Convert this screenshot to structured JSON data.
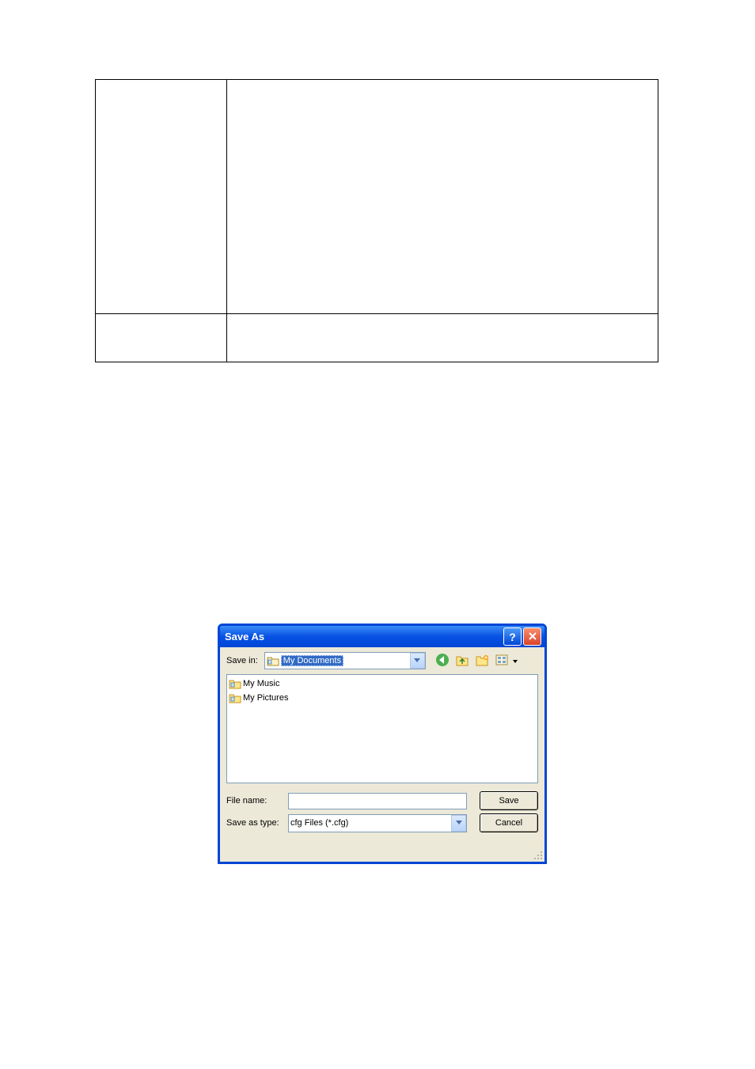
{
  "dialog": {
    "title": "Save As",
    "save_in_label": "Save in:",
    "save_in_selected": "My Documents",
    "file_list": [
      {
        "name": "My Music"
      },
      {
        "name": "My Pictures"
      }
    ],
    "file_name_label": "File name:",
    "file_name_value": "",
    "save_as_type_label": "Save as type:",
    "save_as_type_value": "cfg Files (*.cfg)",
    "save_button": "Save",
    "cancel_button": "Cancel"
  }
}
